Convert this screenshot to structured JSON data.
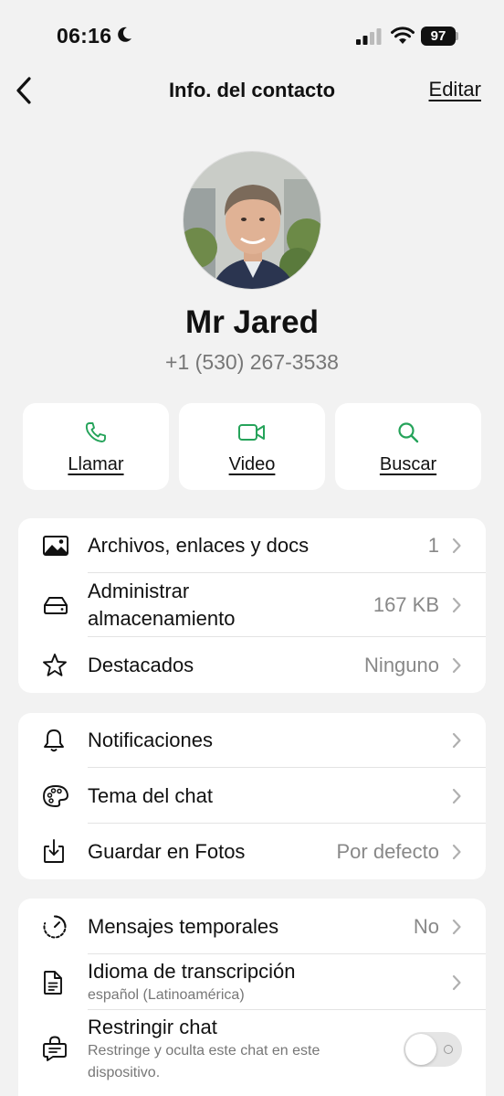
{
  "status_bar": {
    "time": "06:16",
    "battery": "97"
  },
  "nav": {
    "title": "Info. del contacto",
    "edit_label": "Editar"
  },
  "contact": {
    "name": "Mr Jared",
    "phone": "+1 (530) 267-3538"
  },
  "actions": [
    {
      "label": "Llamar",
      "icon": "phone-icon"
    },
    {
      "label": "Video",
      "icon": "video-icon"
    },
    {
      "label": "Buscar",
      "icon": "search-icon"
    }
  ],
  "accent_color": "#25a35a",
  "section1": [
    {
      "label": "Archivos, enlaces y docs",
      "value": "1",
      "icon": "image-icon"
    },
    {
      "label_line1": "Administrar",
      "label_line2": "almacenamiento",
      "value": "167 KB",
      "icon": "storage-icon"
    },
    {
      "label": "Destacados",
      "value": "Ninguno",
      "icon": "star-icon"
    }
  ],
  "section2": [
    {
      "label": "Notificaciones",
      "icon": "bell-icon"
    },
    {
      "label": "Tema del chat",
      "icon": "palette-icon"
    },
    {
      "label": "Guardar en Fotos",
      "value": "Por defecto",
      "icon": "save-photos-icon"
    }
  ],
  "section3": [
    {
      "label": "Mensajes temporales",
      "value": "No",
      "icon": "timer-icon"
    },
    {
      "label": "Idioma de transcripción",
      "sub": "español (Latinoamérica)",
      "icon": "document-icon"
    },
    {
      "label": "Restringir chat",
      "sub_line1": "Restringe y oculta este chat en este",
      "sub_line2": "dispositivo.",
      "icon": "lock-chat-icon",
      "toggle_on": false
    }
  ]
}
